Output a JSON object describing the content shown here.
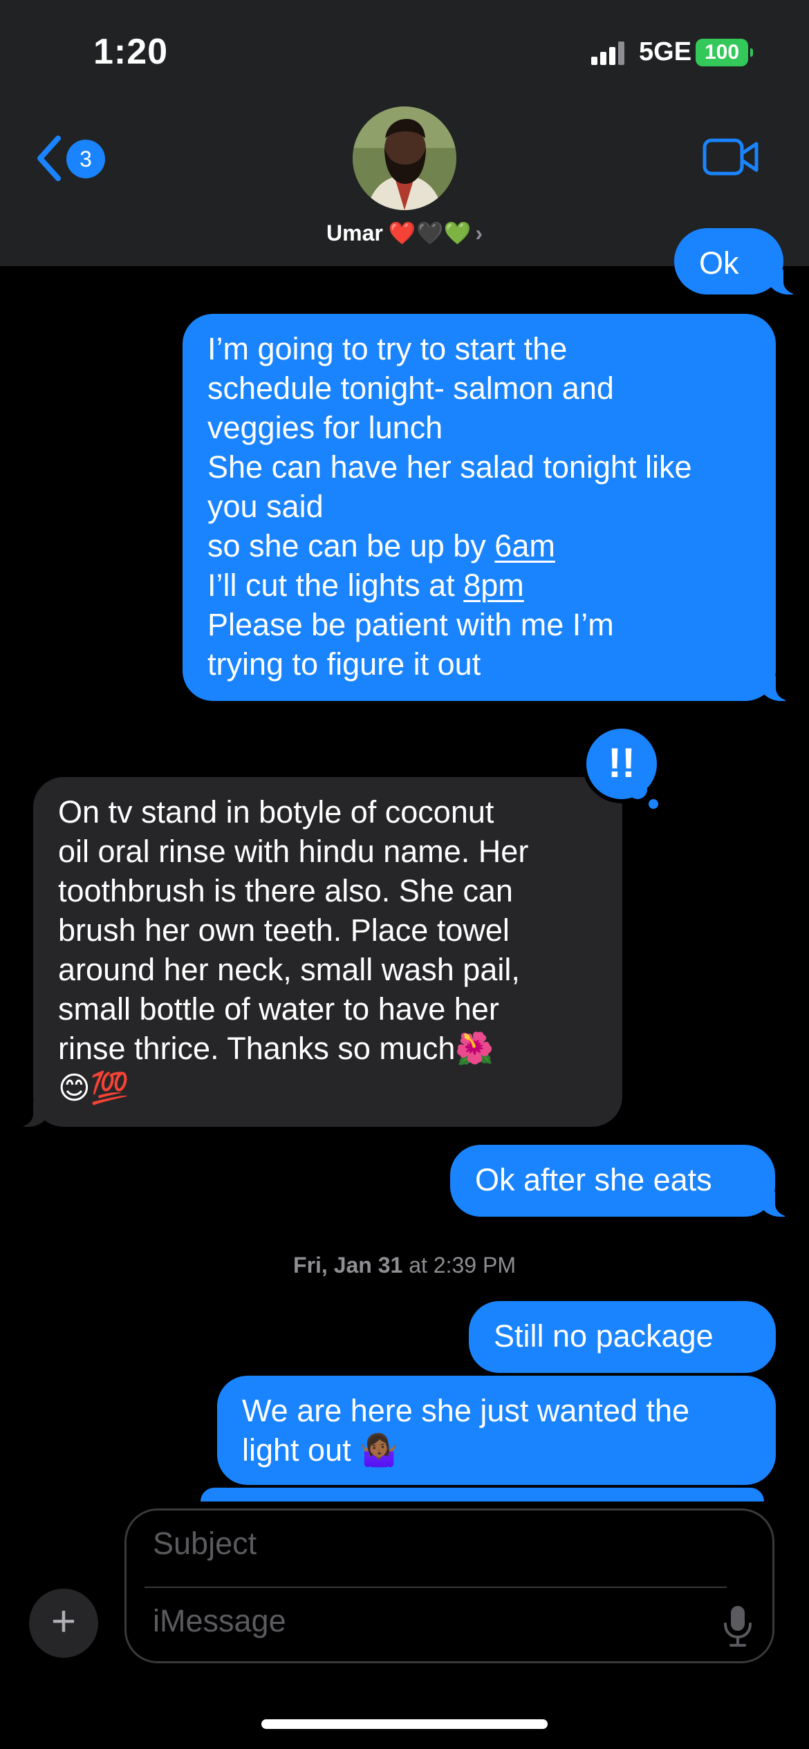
{
  "status": {
    "time": "1:20",
    "network": "5GE",
    "battery": "100"
  },
  "header": {
    "back_count": "3",
    "contact_name": "Umar",
    "name_hearts": "❤️🖤💚",
    "chevron": "›"
  },
  "messages": [
    {
      "direction": "sent",
      "lines": [
        "Ok"
      ]
    },
    {
      "direction": "sent",
      "lines": [
        "I’m going to try to start the",
        "schedule tonight-  salmon and",
        "veggies for lunch",
        "She can have her salad tonight like",
        "you said",
        "so  she can be up by 6am",
        "I’ll cut the lights at 8pm",
        "Please be patient with me I’m",
        "trying to figure it out"
      ],
      "links": [
        "6am",
        "8pm"
      ]
    },
    {
      "direction": "received",
      "tapback": "!!",
      "lines": [
        "On tv stand in botyle of coconut",
        "oil oral rinse with hindu name. Her",
        "toothbrush is there also. She can",
        "brush her own teeth. Place towel",
        "around her neck, small wash pail,",
        "small bottle of water to have her",
        "rinse thrice. Thanks so much🌺",
        "😊💯"
      ]
    },
    {
      "direction": "sent",
      "lines": [
        "Ok after she eats"
      ]
    },
    {
      "direction": "sent",
      "lines": [
        "Still no package"
      ]
    },
    {
      "direction": "sent",
      "lines": [
        "We are here she just wanted the",
        "light out 🤷🏾‍♀️"
      ]
    }
  ],
  "timestamp": {
    "date": "Fri, Jan 31",
    "at": " at ",
    "time": "2:39 PM"
  },
  "composer": {
    "subject_placeholder": "Subject",
    "message_placeholder": "iMessage",
    "plus": "+"
  },
  "colors": {
    "sent_bubble": "#1a84ff",
    "received_bubble": "#262628",
    "header_bg": "#202223",
    "battery": "#34c759"
  }
}
